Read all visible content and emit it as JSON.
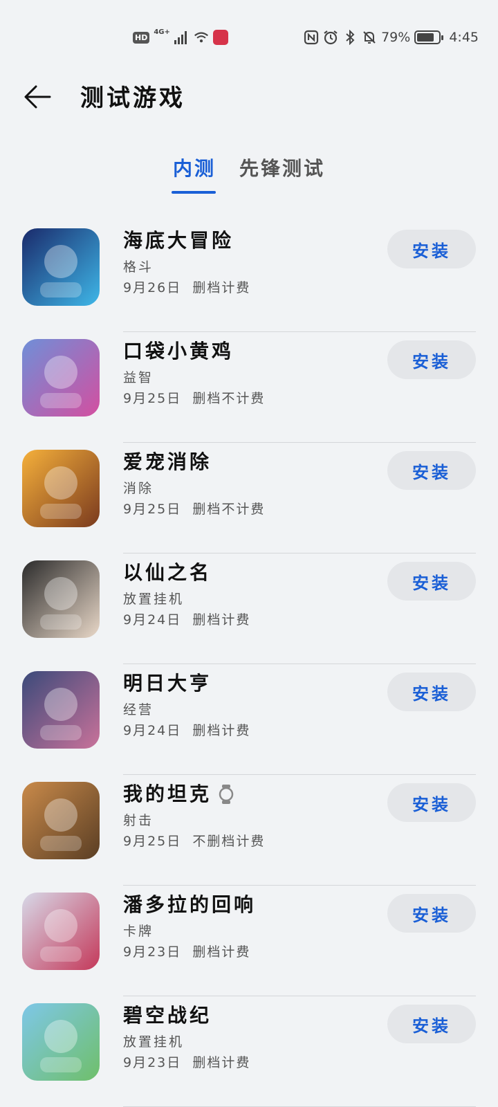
{
  "status_bar": {
    "hd": "HD",
    "network": "4G+",
    "battery_percent": "79%",
    "battery_level": 0.79,
    "time": "4:45"
  },
  "header": {
    "title": "测试游戏"
  },
  "tabs": [
    {
      "label": "内测",
      "active": true
    },
    {
      "label": "先锋测试",
      "active": false
    }
  ],
  "install_label": "安装",
  "games": [
    {
      "name": "海底大冒险",
      "category": "格斗",
      "date": "9月26日",
      "data_note": "删档计费",
      "icon": "ninja-game-icon",
      "colors": [
        "#1a2a6b",
        "#3fb7e8"
      ]
    },
    {
      "name": "口袋小黄鸡",
      "category": "益智",
      "date": "9月25日",
      "data_note": "删档不计费",
      "icon": "pixel-chicken-game-icon",
      "colors": [
        "#6f8fd8",
        "#d34fa0"
      ]
    },
    {
      "name": "爱宠消除",
      "category": "消除",
      "date": "9月25日",
      "data_note": "删档不计费",
      "icon": "cake-game-icon",
      "colors": [
        "#f5b03b",
        "#7a3a1e"
      ]
    },
    {
      "name": "以仙之名",
      "category": "放置挂机",
      "date": "9月24日",
      "data_note": "删档计费",
      "icon": "xianxia-character-game-icon",
      "colors": [
        "#2b2b2b",
        "#e9d8c8"
      ]
    },
    {
      "name": "明日大亨",
      "category": "经营",
      "date": "9月24日",
      "data_note": "删档计费",
      "icon": "tycoon-characters-game-icon",
      "colors": [
        "#3b4a7a",
        "#c9729a"
      ]
    },
    {
      "name": "我的坦克",
      "category": "射击",
      "date": "9月25日",
      "data_note": "不删档计费",
      "icon": "tank-game-icon",
      "colors": [
        "#c98a4a",
        "#5a3e24"
      ],
      "watch": true
    },
    {
      "name": "潘多拉的回响",
      "category": "卡牌",
      "date": "9月23日",
      "data_note": "删档计费",
      "icon": "anime-girl-game-icon",
      "colors": [
        "#d7d9e8",
        "#c4395a"
      ]
    },
    {
      "name": "碧空战纪",
      "category": "放置挂机",
      "date": "9月23日",
      "data_note": "删档计费",
      "icon": "green-hair-girl-game-icon",
      "colors": [
        "#7ec7e8",
        "#6fbf6a"
      ]
    }
  ]
}
